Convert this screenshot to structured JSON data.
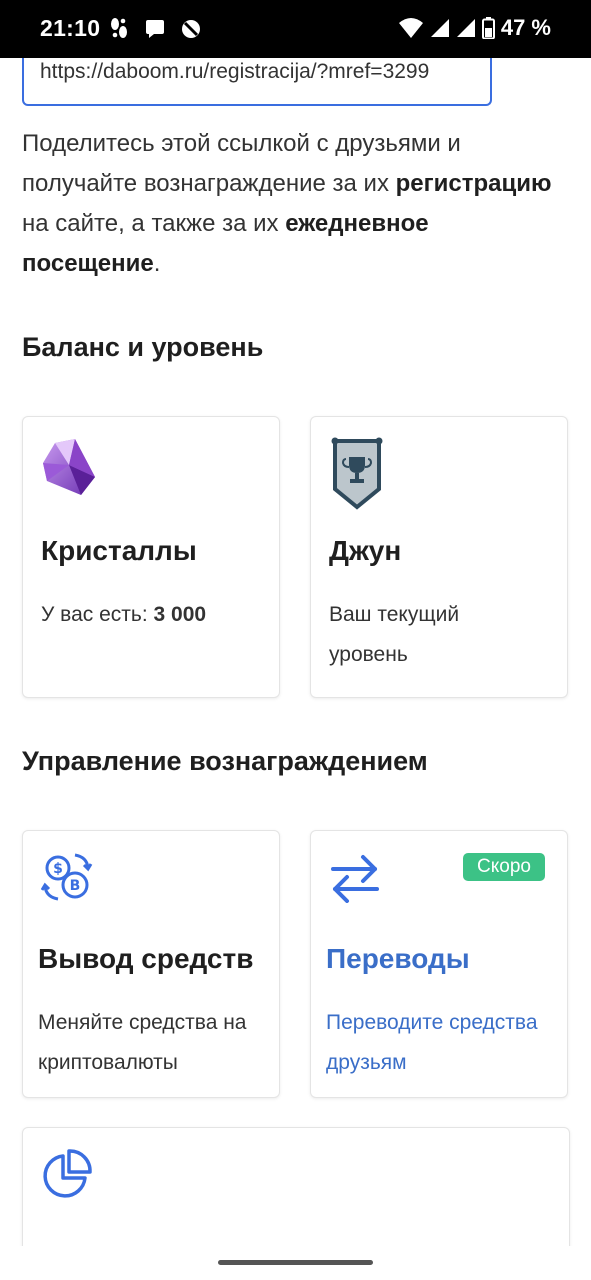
{
  "status_bar": {
    "time": "21:10",
    "battery": "47 %",
    "notification_icons": [
      "footsteps-icon",
      "chat-bubble-icon",
      "no-disturb-icon"
    ],
    "right_icons": [
      "wifi-icon",
      "signal-icon",
      "signal-icon",
      "battery-icon"
    ]
  },
  "referral": {
    "link_value": "https://daboom.ru/registracija/?mref=3299",
    "description_part1": "Поделитесь этой ссылкой с друзьями и получайте вознаграждение за их ",
    "description_bold1": "регистрацию",
    "description_part2": " на сайте, а также за их ",
    "description_bold2": "ежедневное посещение",
    "description_part3": "."
  },
  "balance_section": {
    "heading": "Баланс и уровень",
    "crystals": {
      "title": "Кристаллы",
      "prefix": "У вас есть: ",
      "amount": "3 000",
      "icon": "crystal-icon"
    },
    "level": {
      "title": "Джун",
      "subtitle": "Ваш текущий уровень",
      "icon": "trophy-shield-icon"
    }
  },
  "reward_section": {
    "heading": "Управление вознаграждением",
    "withdraw": {
      "title": "Вывод средств",
      "subtitle": "Меняйте средства на криптовалюты",
      "icon": "currency-exchange-icon"
    },
    "transfers": {
      "title": "Переводы",
      "subtitle": "Переводите средства друзьям",
      "badge": "Скоро",
      "icon": "transfer-arrows-icon"
    },
    "third_card": {
      "icon": "pie-chart-icon"
    }
  },
  "colors": {
    "accent": "#3a6ee0",
    "link_blue": "#3a6ec8",
    "badge_green": "#3cc286",
    "icon_blue": "#3a6ee0"
  }
}
